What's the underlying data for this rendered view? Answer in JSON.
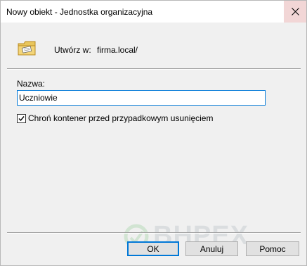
{
  "window": {
    "title": "Nowy obiekt - Jednostka organizacyjna",
    "close_icon": "close-icon"
  },
  "header": {
    "icon": "organizational-unit-icon",
    "create_in_label": "Utwórz w:",
    "create_in_value": "firma.local/"
  },
  "form": {
    "name_label": "Nazwa:",
    "name_value": "Uczniowie",
    "protect_checkbox_label": "Chroń kontener przed przypadkowym usunięciem",
    "protect_checkbox_checked": true
  },
  "buttons": {
    "ok": "OK",
    "cancel": "Anuluj",
    "help": "Pomoc"
  },
  "watermark": {
    "text": "BHPEX"
  },
  "colors": {
    "accent": "#0078d7",
    "dialog_bg": "#f0f0f0",
    "close_hover": "#f2d6d6"
  }
}
